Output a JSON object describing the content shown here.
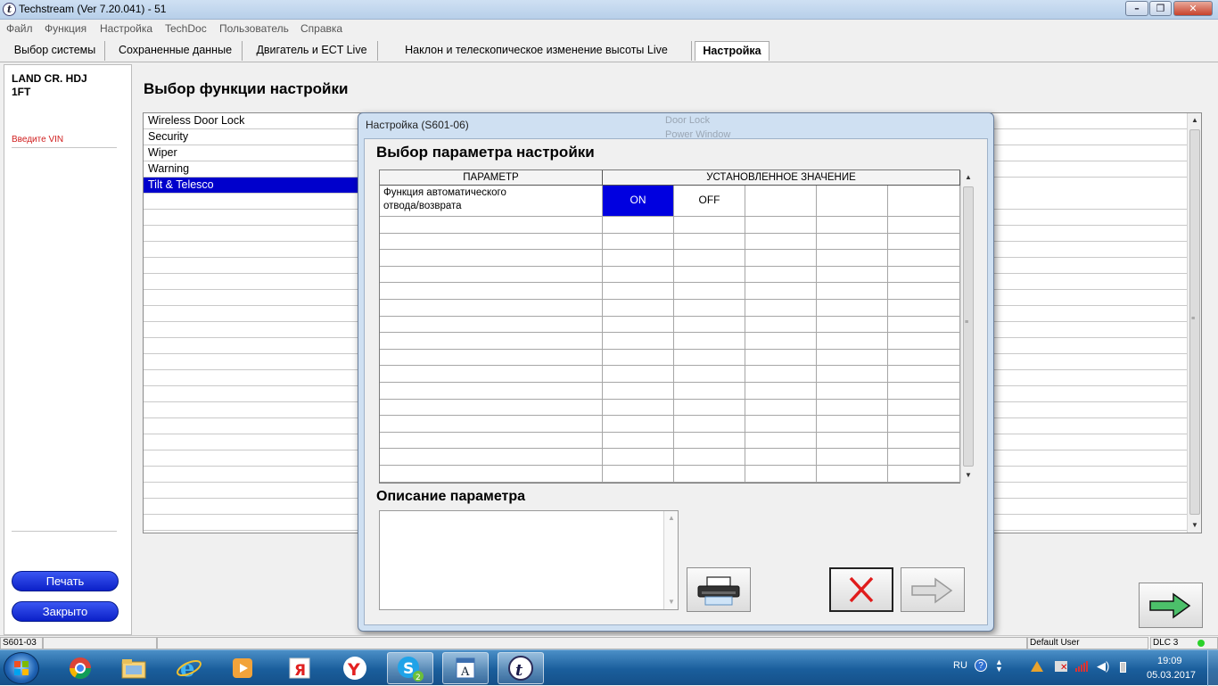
{
  "window": {
    "title": "Techstream (Ver 7.20.041) - 51",
    "app_icon": "t-logo-icon"
  },
  "menu": [
    "Файл",
    "Функция",
    "Настройка",
    "TechDoc",
    "Пользователь",
    "Справка"
  ],
  "tabs": [
    {
      "label": "Выбор системы"
    },
    {
      "label": "Сохраненные данные"
    },
    {
      "label": "Двигатель и ECT Live"
    },
    {
      "label": "Наклон и телескопическое изменение высоты Live"
    },
    {
      "label": "Настройка",
      "active": true
    }
  ],
  "left_panel": {
    "vehicle_line1": "LAND CR. HDJ",
    "vehicle_line2": "1FT",
    "vin_prompt": "Введите VIN",
    "print_label": "Печать",
    "close_label": "Закрыто"
  },
  "main": {
    "heading": "Выбор функции настройки",
    "functions": [
      "Wireless Door Lock",
      "Security",
      "Wiper",
      "Warning",
      "Tilt & Telesco"
    ],
    "selected_function": "Tilt & Telesco",
    "behind_dialog_text": [
      "Door Lock",
      "Power Window"
    ]
  },
  "dialog": {
    "title": "Настройка (S601-06)",
    "heading": "Выбор параметра настройки",
    "col_param": "ПАРАМЕТР",
    "col_value": "УСТАНОВЛЕННОЕ ЗНАЧЕНИЕ",
    "param_line1": "Функция автоматического",
    "param_line2": "отвода/возврата",
    "value_on": "ON",
    "value_off": "OFF",
    "selected_value": "ON",
    "desc_heading": "Описание параметра"
  },
  "status_bar": {
    "code": "S601-03",
    "user": "Default User",
    "dlc": "DLC 3"
  },
  "taskbar": {
    "apps": [
      "chrome-icon",
      "explorer-icon",
      "ie-icon",
      "media-icon",
      "yandex-icon",
      "yandex-browser-icon",
      "skype-icon",
      "wordpad-icon",
      "techstream-icon"
    ],
    "skype_badge": "2",
    "lang": "RU",
    "time": "19:09",
    "date": "05.03.2017"
  },
  "colors": {
    "selection": "#0000cc",
    "pill_button": "#1428dc",
    "vin_text": "#d01e1e",
    "dialog_frame": "#cfe0f2"
  }
}
